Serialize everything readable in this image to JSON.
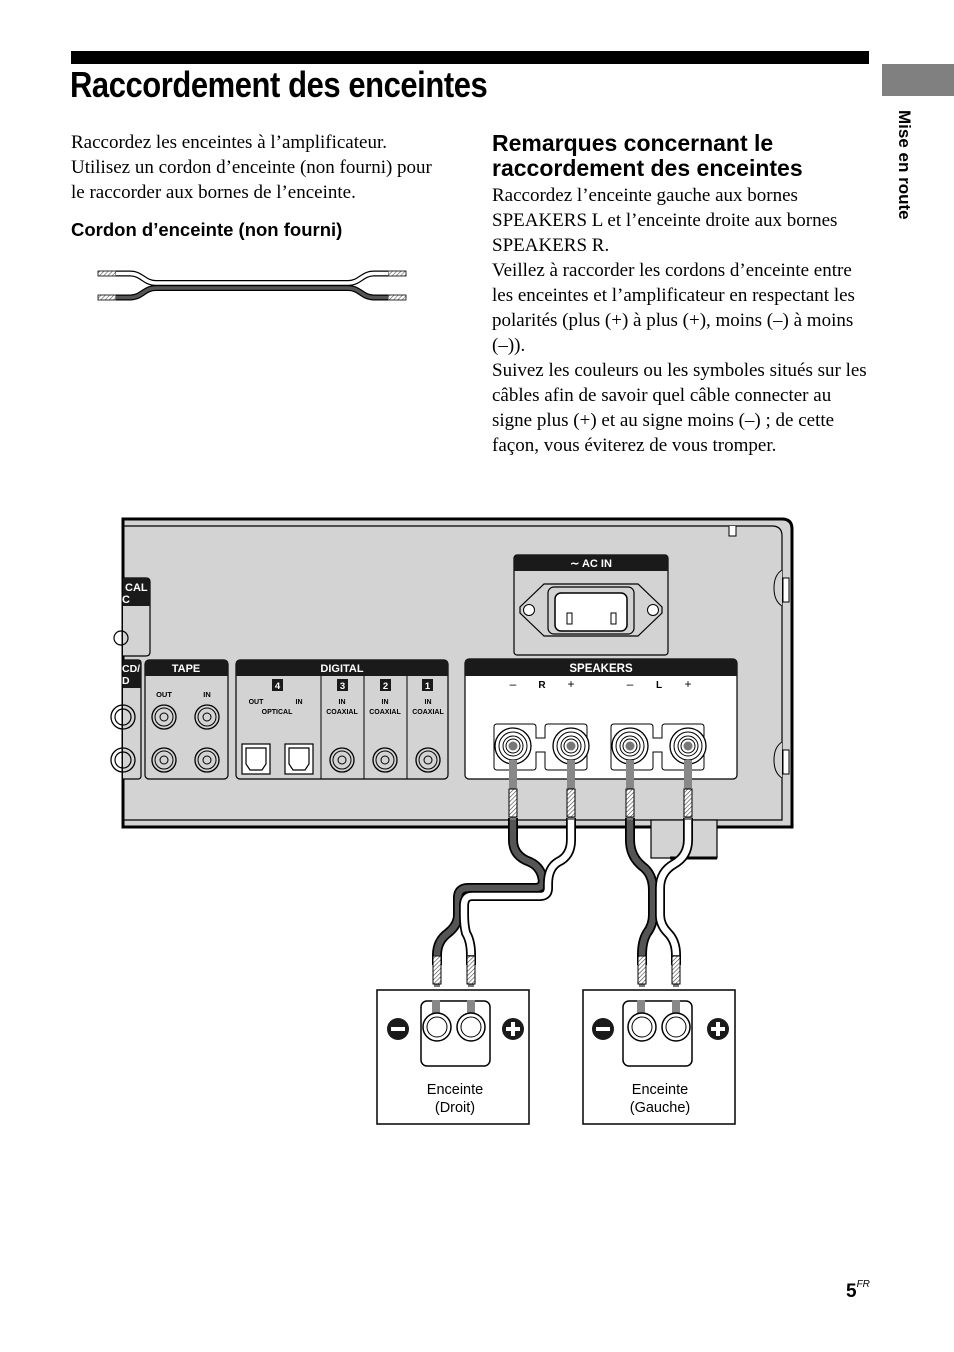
{
  "header": {
    "title": "Raccordement des enceintes",
    "section_tab": "Mise en route"
  },
  "left_column": {
    "intro": "Raccordez les enceintes à l’amplificateur. Utilisez un cordon d’enceinte (non fourni) pour le raccorder aux bornes de l’enceinte.",
    "cord_heading": "Cordon d’enceinte (non fourni)"
  },
  "right_column": {
    "heading_line1": "Remarques concernant le",
    "heading_line2": "raccordement des enceintes",
    "paragraphs": [
      "Raccordez l’enceinte gauche aux bornes SPEAKERS L et l’enceinte droite aux bornes SPEAKERS R.",
      "Veillez à raccorder les cordons d’enceinte entre les enceintes et l’amplificateur en respectant les polarités (plus (+) à plus (+), moins (–) à moins (–)).",
      "Suivez les couleurs ou les symboles situés sur les câbles afin de savoir quel câble connecter au signe plus (+) et au signe moins (–) ; de cette façon, vous éviterez de vous tromper."
    ]
  },
  "diagram": {
    "panel_labels": {
      "cal": "CAL",
      "cal2": "C",
      "cd": "CD/",
      "cd2": "D",
      "tape": "TAPE",
      "tape_out": "OUT",
      "tape_in": "IN",
      "digital": "DIGITAL",
      "opt_num": "4",
      "opt_out": "OUT",
      "opt_in": "IN",
      "optical": "OPTICAL",
      "coax3_num": "3",
      "coax2_num": "2",
      "coax1_num": "1",
      "coax_in": "IN",
      "coaxial": "COAXIAL",
      "ac_in": "AC IN",
      "speakers": "SPEAKERS",
      "minus": "–",
      "plus": "+",
      "r": "R",
      "l": "L"
    },
    "speaker_right": {
      "line1": "Enceinte",
      "line2": "(Droit)"
    },
    "speaker_left": {
      "line1": "Enceinte",
      "line2": "(Gauche)"
    }
  },
  "footer": {
    "page_number": "5",
    "page_suffix": "FR"
  }
}
